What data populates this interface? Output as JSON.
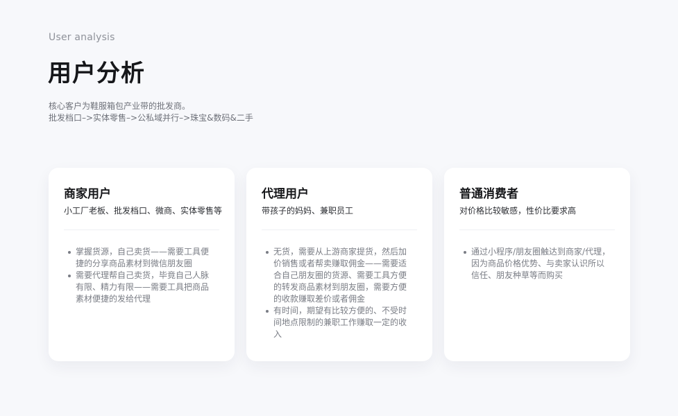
{
  "header": {
    "subtitle_en": "User analysis",
    "title": "用户分析",
    "intro_line1": "核心客户为鞋服箱包产业带的批发商。",
    "intro_line2": "批发档口–>实体零售–>公私域并行–>珠宝&数码&二手"
  },
  "cards": [
    {
      "title": "商家用户",
      "desc": "小工厂老板、批发档口、微商、实体零售等",
      "points": [
        "掌握货源，自己卖货——需要工具便捷的分享商品素材到微信朋友圈",
        "需要代理帮自己卖货，毕竟自己人脉有限、精力有限——需要工具把商品素材便捷的发给代理"
      ]
    },
    {
      "title": "代理用户",
      "desc": "带孩子的妈妈、兼职员工",
      "points": [
        "无货，需要从上游商家提货，然后加价销售或者帮卖赚取佣金——需要适合自己朋友圈的货源、需要工具方便的转发商品素材到朋友圈，需要方便的收款赚取差价或者佣金",
        "有时间，期望有比较方便的、不受时间地点限制的兼职工作赚取一定的收入"
      ]
    },
    {
      "title": "普通消费者",
      "desc": "对价格比较敏感，性价比要求高",
      "points": [
        "通过小程序/朋友圈触达到商家/代理，因为商品价格优势、与卖家认识所以信任、朋友种草等而购买"
      ]
    }
  ]
}
